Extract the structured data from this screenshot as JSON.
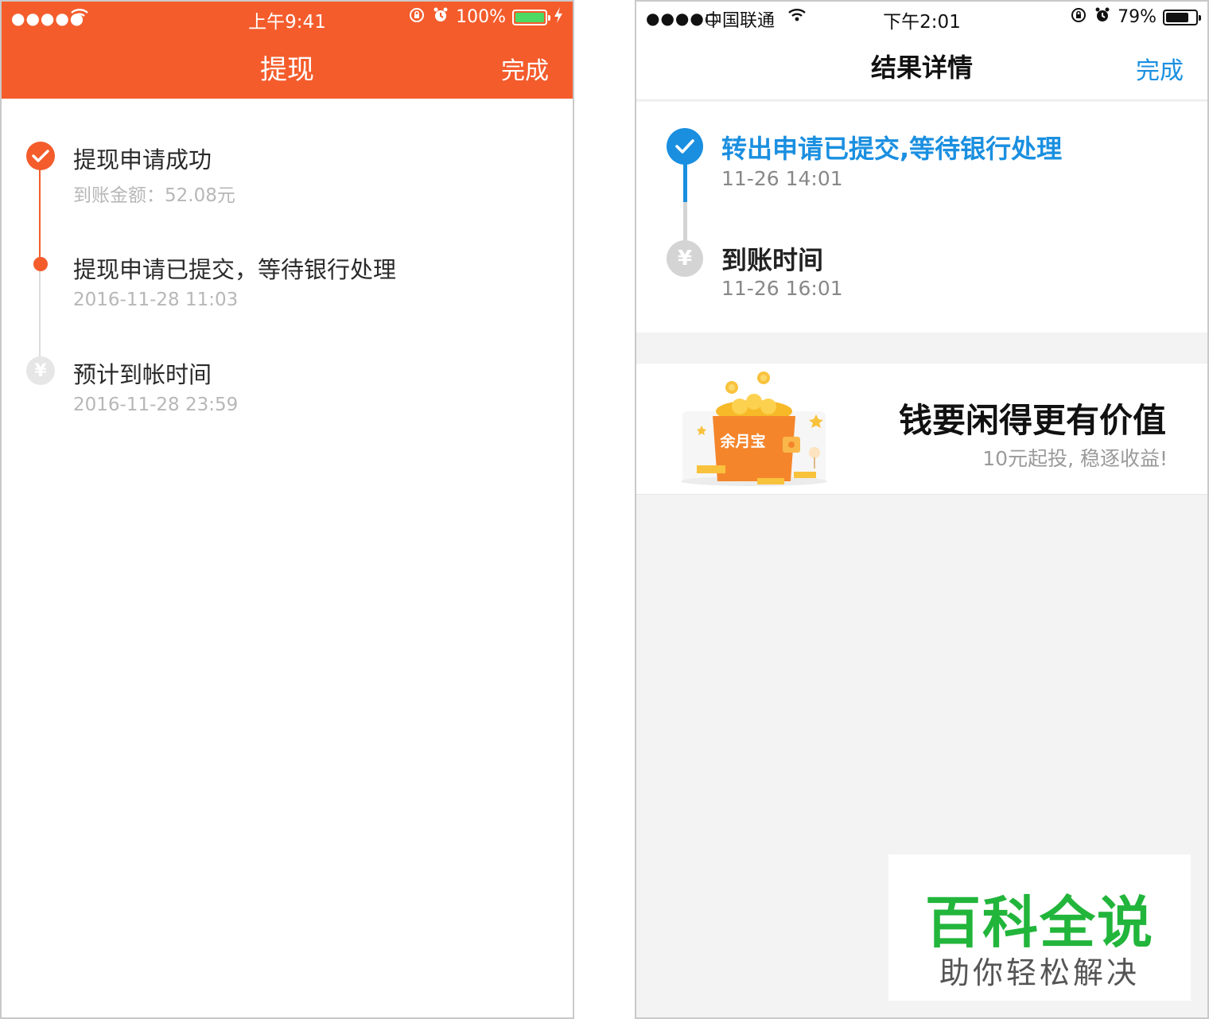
{
  "left": {
    "status_bar": {
      "signal": "●●●●●",
      "time": "上午9:41",
      "battery_text": "100%",
      "battery_level": 1.0
    },
    "nav": {
      "title": "提现",
      "done": "完成"
    },
    "steps": [
      {
        "title": "提现申请成功",
        "sub": "到账金额：52.08元",
        "state": "done"
      },
      {
        "title": "提现申请已提交，等待银行处理",
        "sub": "2016-11-28 11:03",
        "state": "current"
      },
      {
        "title": "预计到帐时间",
        "sub": "2016-11-28 23:59",
        "state": "pending"
      }
    ],
    "yen_glyph": "¥"
  },
  "right": {
    "status_bar": {
      "signal": "●●●●○",
      "carrier": "中国联通",
      "time": "下午2:01",
      "battery_text": "79%",
      "battery_level": 0.79
    },
    "nav": {
      "title": "结果详情",
      "done": "完成"
    },
    "steps": [
      {
        "title": "转出申请已提交,等待银行处理",
        "sub": "11-26 14:01",
        "state": "done"
      },
      {
        "title": "到账时间",
        "sub": "11-26 16:01",
        "state": "pending"
      }
    ],
    "yen_glyph": "¥",
    "banner": {
      "title": "钱要闲得更有价值",
      "sub": "10元起投, 稳逐收益!",
      "art_label": "余月宝"
    },
    "watermark": {
      "main": "百科全说",
      "sub": "助你轻松解决"
    }
  },
  "colors": {
    "left_accent": "#f45c2c",
    "right_accent": "#1a8fe0",
    "watermark_green": "#22b53b"
  }
}
